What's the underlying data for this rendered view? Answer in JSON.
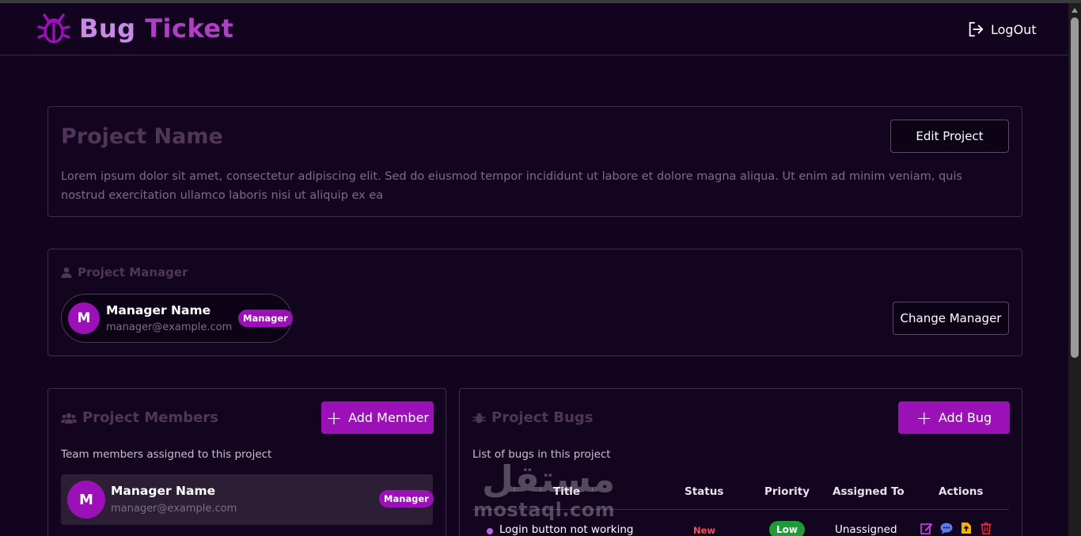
{
  "app": {
    "title_part1": "Bug",
    "title_part2": "Ticket",
    "logout_label": "LogOut"
  },
  "project": {
    "name": "Project Name",
    "description": "Lorem ipsum dolor sit amet, consectetur adipiscing elit. Sed do eiusmod tempor incididunt ut labore et dolore magna aliqua. Ut enim ad minim veniam, quis nostrud exercitation ullamco laboris nisi ut aliquip ex ea",
    "edit_label": "Edit Project"
  },
  "manager_section": {
    "heading": "Project Manager",
    "avatar_initial": "M",
    "name": "Manager Name",
    "email": "manager@example.com",
    "role_badge": "Manager",
    "change_label": "Change Manager"
  },
  "members_section": {
    "heading": "Project Members",
    "add_label": "Add Member",
    "subtitle": "Team members assigned to this project",
    "members": [
      {
        "initial": "M",
        "name": "Manager Name",
        "email": "manager@example.com",
        "role": "Manager"
      }
    ]
  },
  "bugs_section": {
    "heading": "Project Bugs",
    "add_label": "Add Bug",
    "subtitle": "List of bugs in this project",
    "columns": [
      "Title",
      "Status",
      "Priority",
      "Assigned To",
      "Actions"
    ],
    "rows": [
      {
        "title": "Login button not working",
        "status": "New",
        "priority": "Low",
        "assigned": "Unassigned"
      }
    ]
  },
  "watermark": {
    "arabic": "مستقل",
    "latin": "mostaql.com"
  },
  "colors": {
    "background": "#12041f",
    "accent": "#9c10b8",
    "status_new": "#ff4d5e",
    "priority_low": "#1e9a3a"
  },
  "icons": {
    "logo": "bug-icon",
    "logout": "logout-icon",
    "manager": "user-icon",
    "members": "users-icon",
    "bugs": "bug-icon",
    "actions": [
      "edit-icon",
      "comment-icon",
      "file-icon",
      "trash-icon"
    ]
  }
}
